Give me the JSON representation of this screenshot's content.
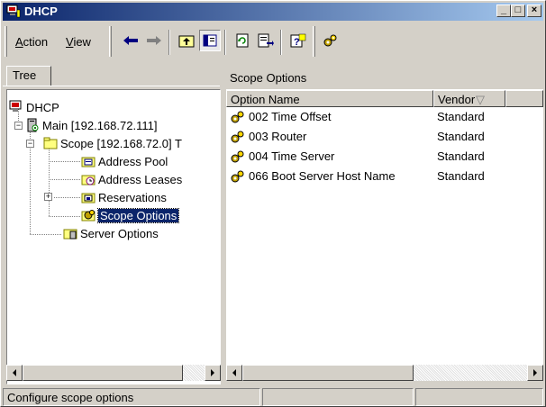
{
  "window": {
    "title": "DHCP"
  },
  "titlebar_buttons": {
    "minimize": "_",
    "maximize": "□",
    "close": "×"
  },
  "menu": {
    "action": {
      "accel": "A",
      "rest": "ction"
    },
    "view": {
      "accel": "V",
      "rest": "iew"
    }
  },
  "toolbar": {
    "icons": [
      "back-arrow-icon",
      "forward-arrow-icon",
      "up-folder-icon",
      "show-hide-tree-icon",
      "refresh-icon",
      "export-list-icon",
      "help-icon",
      "dhcp-options-icon"
    ]
  },
  "tree": {
    "tab_label": "Tree",
    "root": "DHCP",
    "server": "Main [192.168.72.111]",
    "scope": "Scope [192.168.72.0] T",
    "items": [
      "Address Pool",
      "Address Leases",
      "Reservations",
      "Scope Options"
    ],
    "server_options": "Server Options",
    "selected": "Scope Options"
  },
  "right_pane": {
    "header": "Scope Options",
    "columns": {
      "name": "Option Name",
      "vendor": "Vendor",
      "sort_glyph": "▽"
    },
    "rows": [
      {
        "name": "002 Time Offset",
        "vendor": "Standard"
      },
      {
        "name": "003 Router",
        "vendor": "Standard"
      },
      {
        "name": "004 Time Server",
        "vendor": "Standard"
      },
      {
        "name": "066 Boot Server Host Name",
        "vendor": "Standard"
      }
    ]
  },
  "status": {
    "text": "Configure scope options"
  },
  "colors": {
    "title_start": "#0a246a",
    "title_end": "#a6caf0",
    "face": "#d4d0c8",
    "selection": "#0a246a"
  }
}
